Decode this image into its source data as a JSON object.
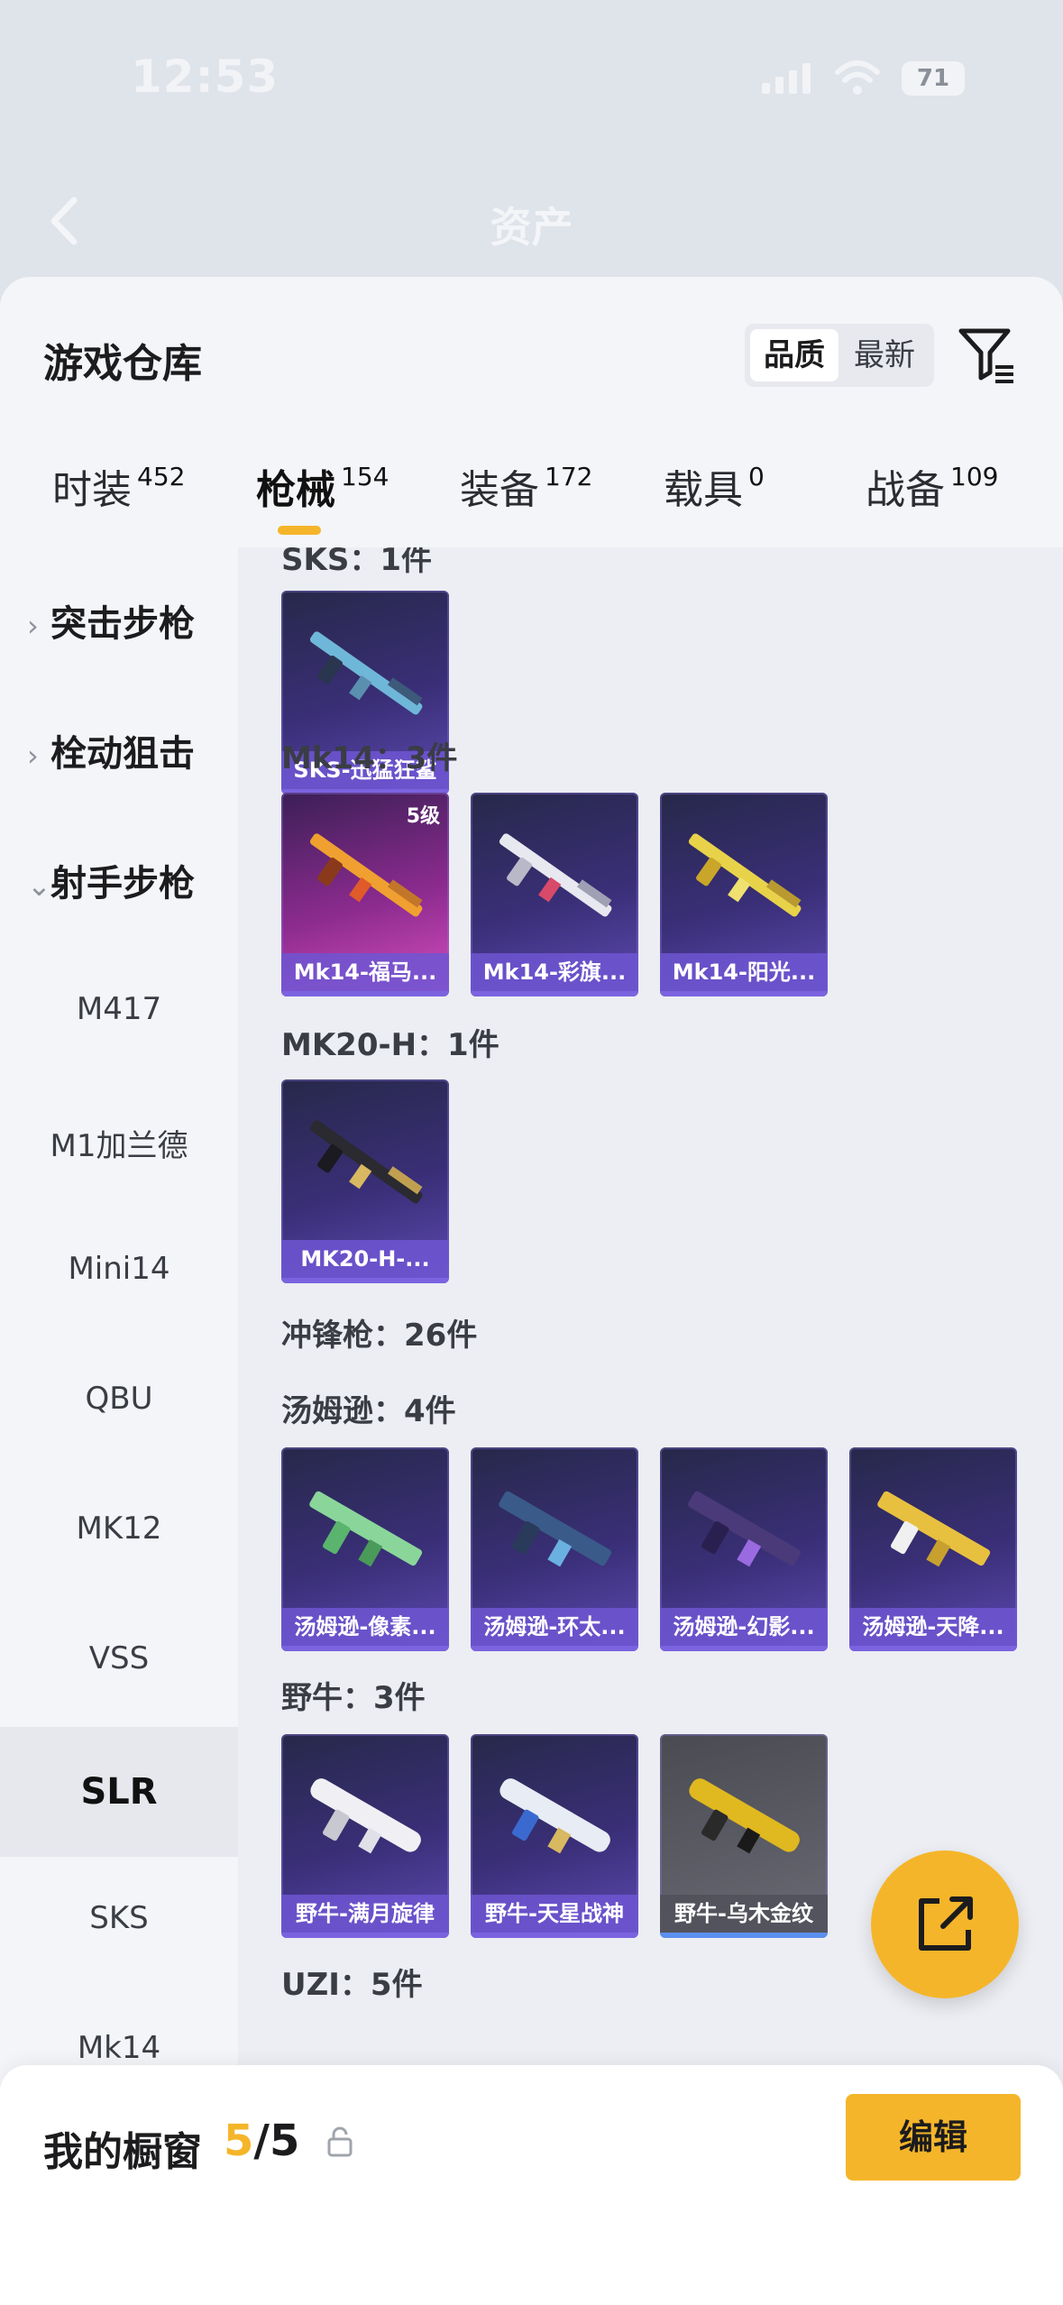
{
  "status_bar": {
    "time": "12:53",
    "battery": "71"
  },
  "nav": {
    "title": "资产"
  },
  "sheet": {
    "title": "游戏仓库",
    "sort_options": [
      "品质",
      "最新"
    ],
    "tabs": [
      {
        "label": "时装",
        "count": "452"
      },
      {
        "label": "枪械",
        "count": "154"
      },
      {
        "label": "装备",
        "count": "172"
      },
      {
        "label": "载具",
        "count": "0"
      },
      {
        "label": "战备",
        "count": "109"
      }
    ]
  },
  "sidebar": {
    "categories": [
      "突击步枪",
      "栓动狙击",
      "射手步枪"
    ],
    "subitems": [
      "M417",
      "M1加兰德",
      "Mini14",
      "QBU",
      "MK12",
      "VSS",
      "SLR",
      "SKS",
      "Mk14"
    ]
  },
  "content": {
    "sec_sks": "SKS：1件",
    "sks_items": [
      "SKS-迅猛狂鲨"
    ],
    "sec_mk14": "Mk14：3件",
    "mk14_items": [
      "Mk14-福马...",
      "Mk14-彩旗...",
      "Mk14-阳光..."
    ],
    "mk14_level": "5级",
    "sec_mk20": "MK20-H：1件",
    "mk20_items": [
      "MK20-H-..."
    ],
    "sec_smg": "冲锋枪：26件",
    "sec_tommy": "汤姆逊：4件",
    "tommy_items": [
      "汤姆逊-像素...",
      "汤姆逊-环太...",
      "汤姆逊-幻影...",
      "汤姆逊-天降..."
    ],
    "sec_bizon": "野牛：3件",
    "bizon_items": [
      "野牛-满月旋律",
      "野牛-天星战神",
      "野牛-乌木金纹"
    ],
    "sec_uzi": "UZI：5件"
  },
  "bottom": {
    "label": "我的橱窗",
    "current": "5",
    "total": "/5",
    "edit": "编辑"
  },
  "colors": {
    "accent": "#f5b52a",
    "card_purple": "#3a2f78",
    "card_pink": "#8c2b8f"
  }
}
